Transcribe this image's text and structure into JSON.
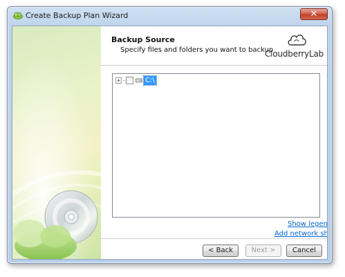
{
  "window": {
    "title": "Create Backup Plan Wizard",
    "close_label": "✕"
  },
  "header": {
    "title": "Backup Source",
    "subtitle": "Specify files and folders you want to backup",
    "brand": "CloudberryLab"
  },
  "tree": {
    "items": [
      {
        "label": "C:\\",
        "expanded": false,
        "checked": false,
        "selected": true,
        "icon": "drive-icon"
      }
    ]
  },
  "links": {
    "show_legend": "Show legend",
    "add_network_share": "Add network share"
  },
  "buttons": {
    "back": "< Back",
    "next": "Next >",
    "cancel": "Cancel"
  },
  "colors": {
    "selection": "#3399ff",
    "link": "#0066cc",
    "close_button": "#c84b33"
  }
}
